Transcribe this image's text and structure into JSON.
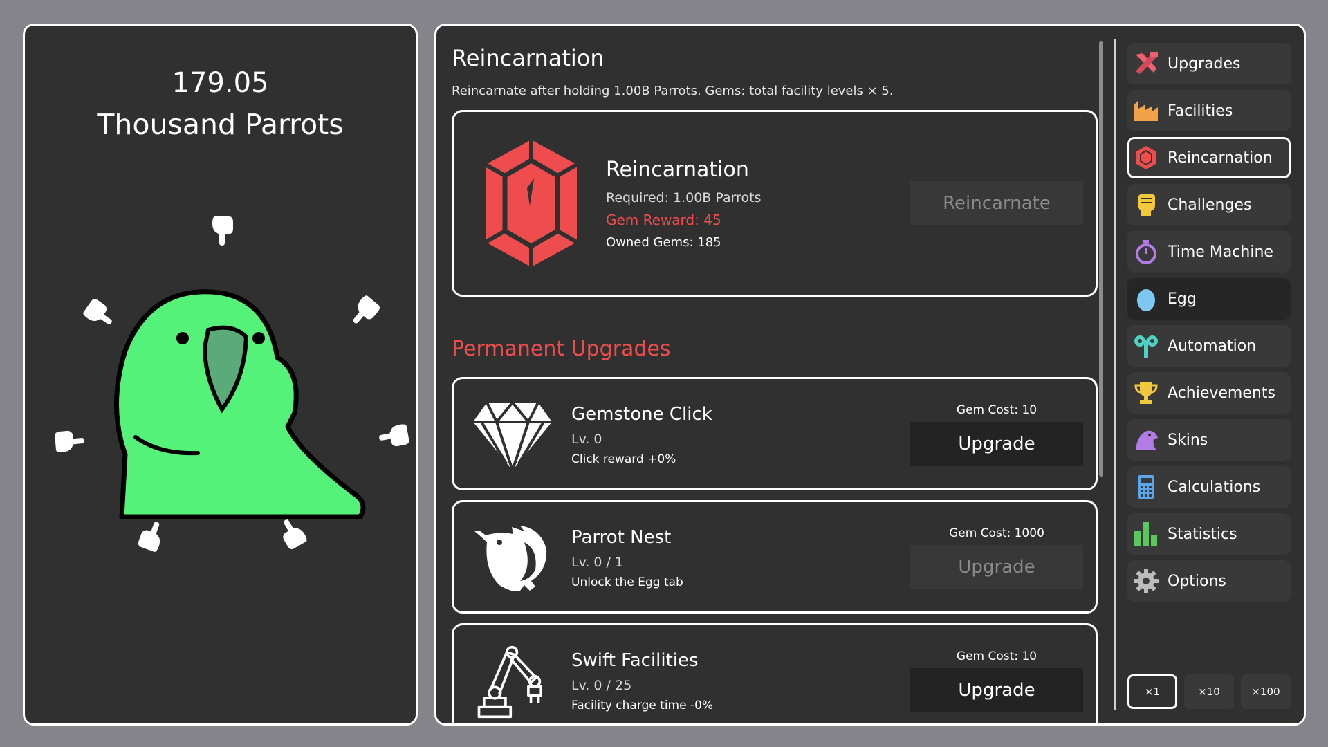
{
  "counter": {
    "amount": "179.05",
    "unit": "Thousand Parrots"
  },
  "reincarnation": {
    "section_title": "Reincarnation",
    "description": "Reincarnate after holding 1.00B Parrots. Gems: total facility levels × 5.",
    "card_title": "Reincarnation",
    "required": "Required: 1.00B Parrots",
    "gem_reward": "Gem Reward: 45",
    "owned_gems": "Owned Gems: 185",
    "button_label": "Reincarnate",
    "button_enabled": false,
    "gem_color": "#ef4d4d"
  },
  "permanent_upgrades": {
    "title": "Permanent Upgrades",
    "items": [
      {
        "name": "Gemstone Click",
        "level": "Lv. 0",
        "description": "Click reward +0%",
        "cost": "Gem Cost: 10",
        "button_label": "Upgrade",
        "enabled": true,
        "icon": "diamond-icon"
      },
      {
        "name": "Parrot Nest",
        "level": "Lv. 0 / 1",
        "description": "Unlock the Egg tab",
        "cost": "Gem Cost: 1000",
        "button_label": "Upgrade",
        "enabled": false,
        "icon": "bird-icon"
      },
      {
        "name": "Swift Facilities",
        "level": "Lv. 0 / 25",
        "description": "Facility charge time -0%",
        "cost": "Gem Cost: 10",
        "button_label": "Upgrade",
        "enabled": true,
        "icon": "robot-arm-icon"
      }
    ]
  },
  "nav": {
    "items": [
      {
        "label": "Upgrades",
        "icon": "tools-icon",
        "active": false
      },
      {
        "label": "Facilities",
        "icon": "factory-icon",
        "active": false
      },
      {
        "label": "Reincarnation",
        "icon": "gem-icon",
        "active": true
      },
      {
        "label": "Challenges",
        "icon": "fist-icon",
        "active": false
      },
      {
        "label": "Time Machine",
        "icon": "stopwatch-icon",
        "active": false
      },
      {
        "label": "Egg",
        "icon": "egg-icon",
        "active": false
      },
      {
        "label": "Automation",
        "icon": "windup-key-icon",
        "active": false
      },
      {
        "label": "Achievements",
        "icon": "trophy-icon",
        "active": false
      },
      {
        "label": "Skins",
        "icon": "bird-head-icon",
        "active": false
      },
      {
        "label": "Calculations",
        "icon": "calculator-icon",
        "active": false
      },
      {
        "label": "Statistics",
        "icon": "bar-chart-icon",
        "active": false
      },
      {
        "label": "Options",
        "icon": "gear-icon",
        "active": false
      }
    ]
  },
  "multipliers": {
    "options": [
      "×1",
      "×10",
      "×100"
    ],
    "selected": "×1"
  },
  "colors": {
    "background": "#84848a",
    "panel": "#303030",
    "accent_red": "#ef4d4d",
    "parrot_green": "#55f27a"
  }
}
